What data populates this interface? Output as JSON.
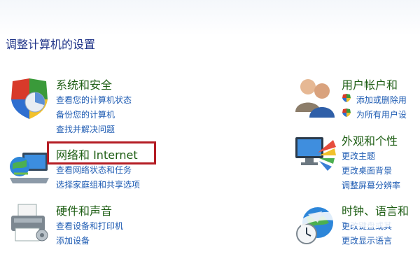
{
  "page": {
    "title": "调整计算机的设置"
  },
  "groups": {
    "system": {
      "title": "系统和安全",
      "links": [
        "查看您的计算机状态",
        "备份您的计算机",
        "查找并解决问题"
      ],
      "icon": "shield-pie-icon"
    },
    "network": {
      "title": "网络和 Internet",
      "links": [
        "查看网络状态和任务",
        "选择家庭组和共享选项"
      ],
      "icon": "globe-network-icon"
    },
    "hardware": {
      "title": "硬件和声音",
      "links": [
        "查看设备和打印机",
        "添加设备"
      ],
      "icon": "printer-icon"
    },
    "users": {
      "title": "用户帐户和",
      "links": [
        "添加或删除用",
        "为所有用户设"
      ],
      "icon": "users-icon"
    },
    "appearance": {
      "title": "外观和个性",
      "links": [
        "更改主题",
        "更改桌面背景",
        "调整屏幕分辨率"
      ],
      "icon": "monitor-palette-icon"
    },
    "clock": {
      "title": "时钟、语言和",
      "links": [
        "更改键盘或其",
        "更改显示语言"
      ],
      "icon": "clock-globe-icon"
    }
  },
  "colors": {
    "title": "#1e3287",
    "category": "#1e5e14",
    "link": "#1f5cb3",
    "highlight": "#b41d24"
  }
}
